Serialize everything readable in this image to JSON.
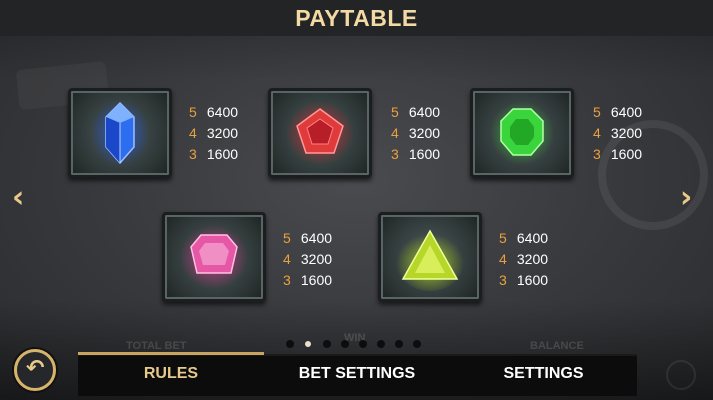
{
  "header": {
    "title": "PAYTABLE"
  },
  "nav": {
    "prev_icon": "chevron-left-icon",
    "next_icon": "chevron-right-icon",
    "prev_glyph": "‹",
    "next_glyph": "›"
  },
  "symbols": [
    {
      "name": "blue-gem",
      "color": "#2a6de0",
      "pays": [
        {
          "count": "5",
          "amount": "6400"
        },
        {
          "count": "4",
          "amount": "3200"
        },
        {
          "count": "3",
          "amount": "1600"
        }
      ]
    },
    {
      "name": "red-gem",
      "color": "#e03a3a",
      "pays": [
        {
          "count": "5",
          "amount": "6400"
        },
        {
          "count": "4",
          "amount": "3200"
        },
        {
          "count": "3",
          "amount": "1600"
        }
      ]
    },
    {
      "name": "green-gem",
      "color": "#38c83a",
      "pays": [
        {
          "count": "5",
          "amount": "6400"
        },
        {
          "count": "4",
          "amount": "3200"
        },
        {
          "count": "3",
          "amount": "1600"
        }
      ]
    },
    {
      "name": "pink-gem",
      "color": "#e04a9a",
      "pays": [
        {
          "count": "5",
          "amount": "6400"
        },
        {
          "count": "4",
          "amount": "3200"
        },
        {
          "count": "3",
          "amount": "1600"
        }
      ]
    },
    {
      "name": "yellow-green-gem",
      "color": "#b6d62a",
      "pays": [
        {
          "count": "5",
          "amount": "6400"
        },
        {
          "count": "4",
          "amount": "3200"
        },
        {
          "count": "3",
          "amount": "1600"
        }
      ]
    }
  ],
  "pagination": {
    "total_pages": 8,
    "active_index": 1
  },
  "footer_ghost": {
    "total_bet": "TOTAL BET",
    "win": "WIN",
    "balance": "BALANCE"
  },
  "back_button": {
    "icon": "undo-arrow-icon",
    "glyph": "↶"
  },
  "tabs": [
    {
      "label": "RULES",
      "active": true
    },
    {
      "label": "BET SETTINGS",
      "active": false
    },
    {
      "label": "SETTINGS",
      "active": false
    }
  ],
  "colors": {
    "accent_gold": "#e7c98b",
    "pay_count": "#e9a13f",
    "tab_bar": "#0c0c0d"
  }
}
